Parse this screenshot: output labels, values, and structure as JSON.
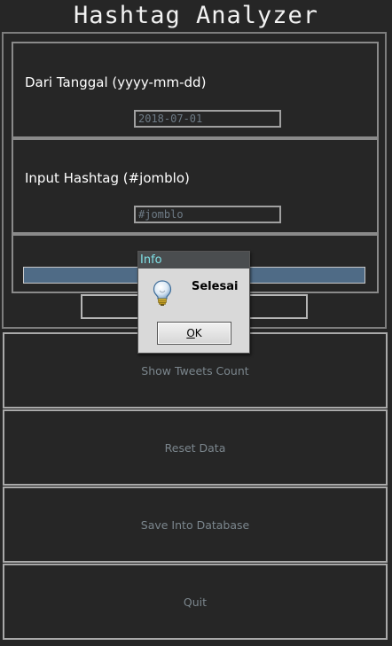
{
  "app": {
    "title": "Hashtag Analyzer"
  },
  "date_panel": {
    "label": "Dari Tanggal (yyyy-mm-dd)",
    "value": "2018-07-01"
  },
  "hashtag_panel": {
    "label": "Input Hashtag (#jomblo)",
    "value": "#jomblo"
  },
  "progress": {
    "fill_fraction": 1.0,
    "fill_color": "#4f6b86"
  },
  "buttons": {
    "show_tweets": "Show Tweets Count",
    "reset": "Reset Data",
    "save": "Save Into Database",
    "quit": "Quit"
  },
  "dialog": {
    "title": "Info",
    "message": "Selesai",
    "ok_mnemonic": "O",
    "ok_rest": "K",
    "icon": "lightbulb-icon"
  },
  "colors": {
    "background": "#262626",
    "dialog_title_text": "#7fe0e6",
    "button_text": "#7b868d"
  }
}
